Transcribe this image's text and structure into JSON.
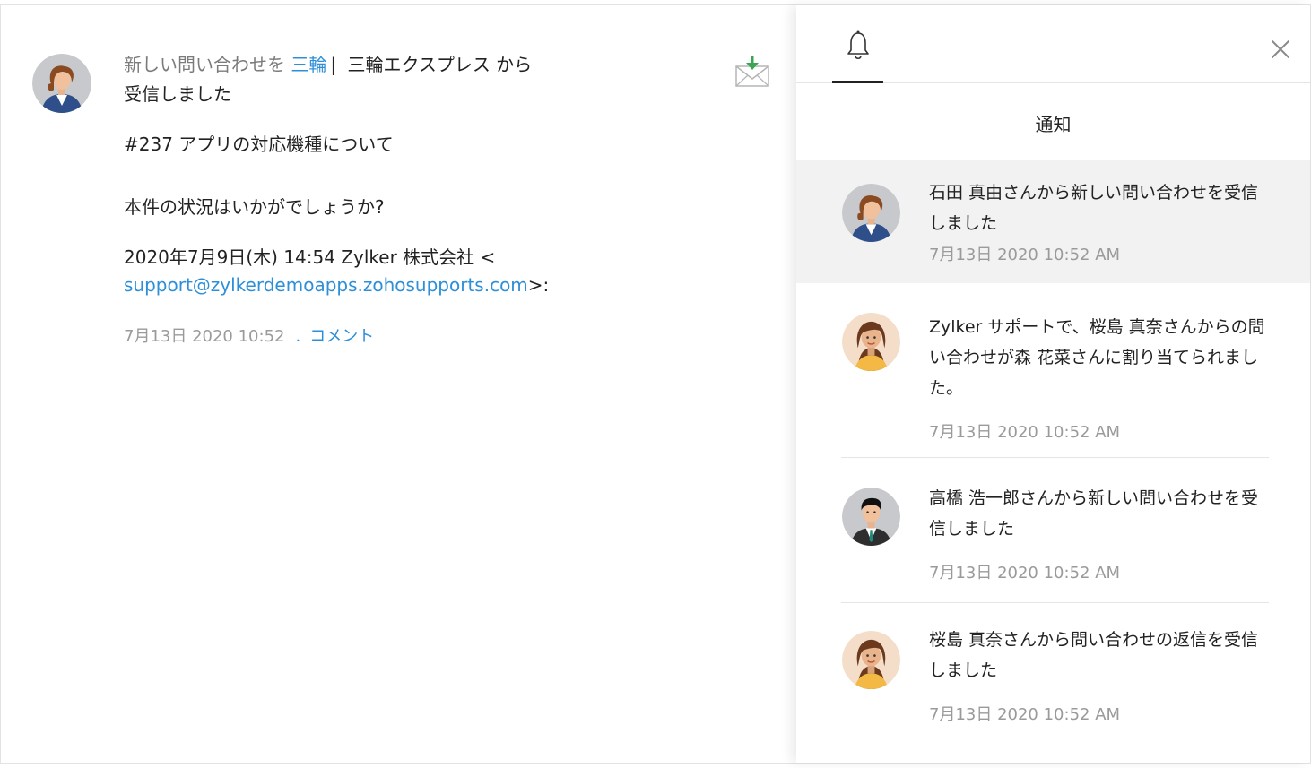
{
  "detail": {
    "header_prefix": "新しい問い合わせを",
    "header_contact": "三輪",
    "header_separator": "|",
    "header_company": "三輪エクスプレス から",
    "header_suffix": "受信しました",
    "ticket_subject": "#237 アプリの対応機種について",
    "body": "本件の状況はいかがでしょうか?",
    "quote_line1": "2020年7月9日(木) 14:54 Zylker 株式会社 <",
    "quote_email": "support@zylkerdemoapps.zohosupports.com",
    "quote_tail": ">:",
    "timestamp": "7月13日 2020 10:52",
    "meta_dot": ".",
    "comment_link": "コメント",
    "inbox_icon": "envelope-download-icon"
  },
  "notifications_panel": {
    "title": "通知",
    "bell_icon": "bell-icon",
    "close_icon": "close-icon",
    "items": [
      {
        "text": "石田 真由さんから新しい問い合わせを受信しました",
        "time": "7月13日 2020 10:52 AM",
        "avatar": "woman-short-hair-avatar",
        "highlighted": true
      },
      {
        "text": "Zylker サポートで、桜島 真奈さんからの問い合わせが森 花菜さんに割り当てられました。",
        "time": "7月13日 2020 10:52 AM",
        "avatar": "woman-long-hair-avatar",
        "highlighted": false
      },
      {
        "text": "高橋 浩一郎さんから新しい問い合わせを受信しました",
        "time": "7月13日 2020 10:52 AM",
        "avatar": "man-suit-avatar",
        "highlighted": false
      },
      {
        "text": "桜島 真奈さんから問い合わせの返信を受信しました",
        "time": "7月13日 2020 10:52 AM",
        "avatar": "woman-long-hair-avatar",
        "highlighted": false
      }
    ]
  },
  "colors": {
    "link": "#2d8fd8",
    "muted": "#9a9a9a",
    "highlight_bg": "#f2f2f2",
    "inbox_arrow": "#3aa655"
  }
}
